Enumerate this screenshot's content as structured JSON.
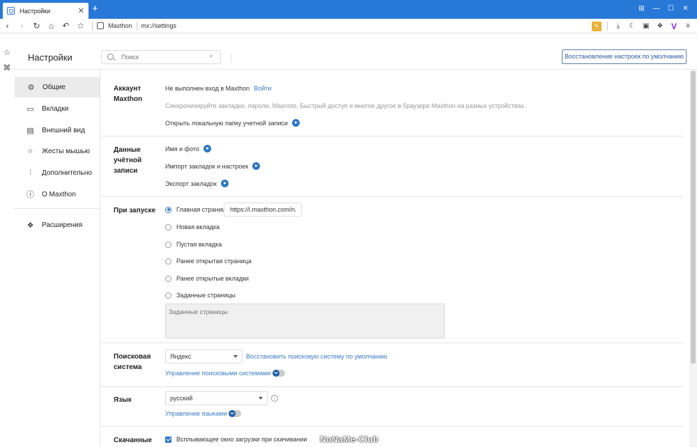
{
  "browser": {
    "tab_title": "Настройки",
    "tab_close": "✕",
    "new_tab": "+",
    "window_buttons": [
      "⊞",
      "—",
      "☐",
      "✕"
    ],
    "site_name": "Maxthon",
    "url": "mx://settings"
  },
  "header": {
    "title": "Настройки",
    "search_placeholder": "Поиск",
    "search_clear": "×",
    "reset_label": "Восстановление настроек по умолчанию"
  },
  "sidebar": {
    "items": [
      {
        "label": "Общие",
        "icon": "gear-icon",
        "active": true
      },
      {
        "label": "Вкладки",
        "icon": "tabs-icon"
      },
      {
        "label": "Внешний вид",
        "icon": "appearance-icon"
      },
      {
        "label": "Жесты мышью",
        "icon": "mouse-icon"
      },
      {
        "label": "Дополнительно",
        "icon": "sliders-icon"
      },
      {
        "label": "О Maxthon",
        "icon": "info-icon"
      },
      {
        "label": "Расширения",
        "icon": "puzzle-icon"
      }
    ]
  },
  "account": {
    "label": "Аккаунт Maxthon",
    "status": "Не выполнен вход в Maxthon",
    "login": "Войти",
    "sync_desc": "Синхронизируйте закладки, пароли, Maxnote, Быстрый доступ и многое другое в браузере Maxthon на разных устройствах.",
    "open_folder": "Открыть локальную папку учетной записи"
  },
  "account_data": {
    "label": "Данные учётной записи",
    "items": [
      "Имя и фото",
      "Импорт закладок и настроек",
      "Экспорт закладок"
    ]
  },
  "startup": {
    "label": "При запуске",
    "options": [
      "Главная страница",
      "Новая вкладка",
      "Пустая вкладка",
      "Ранее открытая страница",
      "Ранее открытые вкладки",
      "Заданные страницы"
    ],
    "selected_index": 0,
    "home_url": "https://i.maxthon.com/ru-",
    "pages_placeholder": "Заданные страницы"
  },
  "search_engine": {
    "label": "Поисковая система",
    "value": "Яндекс",
    "restore": "Восстановить поисковую систему по умолчанию",
    "manage": "Управление поисковыми системами"
  },
  "language": {
    "label": "Язык",
    "value": "русский",
    "info": "i",
    "manage": "Управление языками"
  },
  "downloads": {
    "label": "Скачанные",
    "popup": "Всплывающее окно загрузки при скачивании"
  },
  "watermark": "NoNaMe-Club"
}
